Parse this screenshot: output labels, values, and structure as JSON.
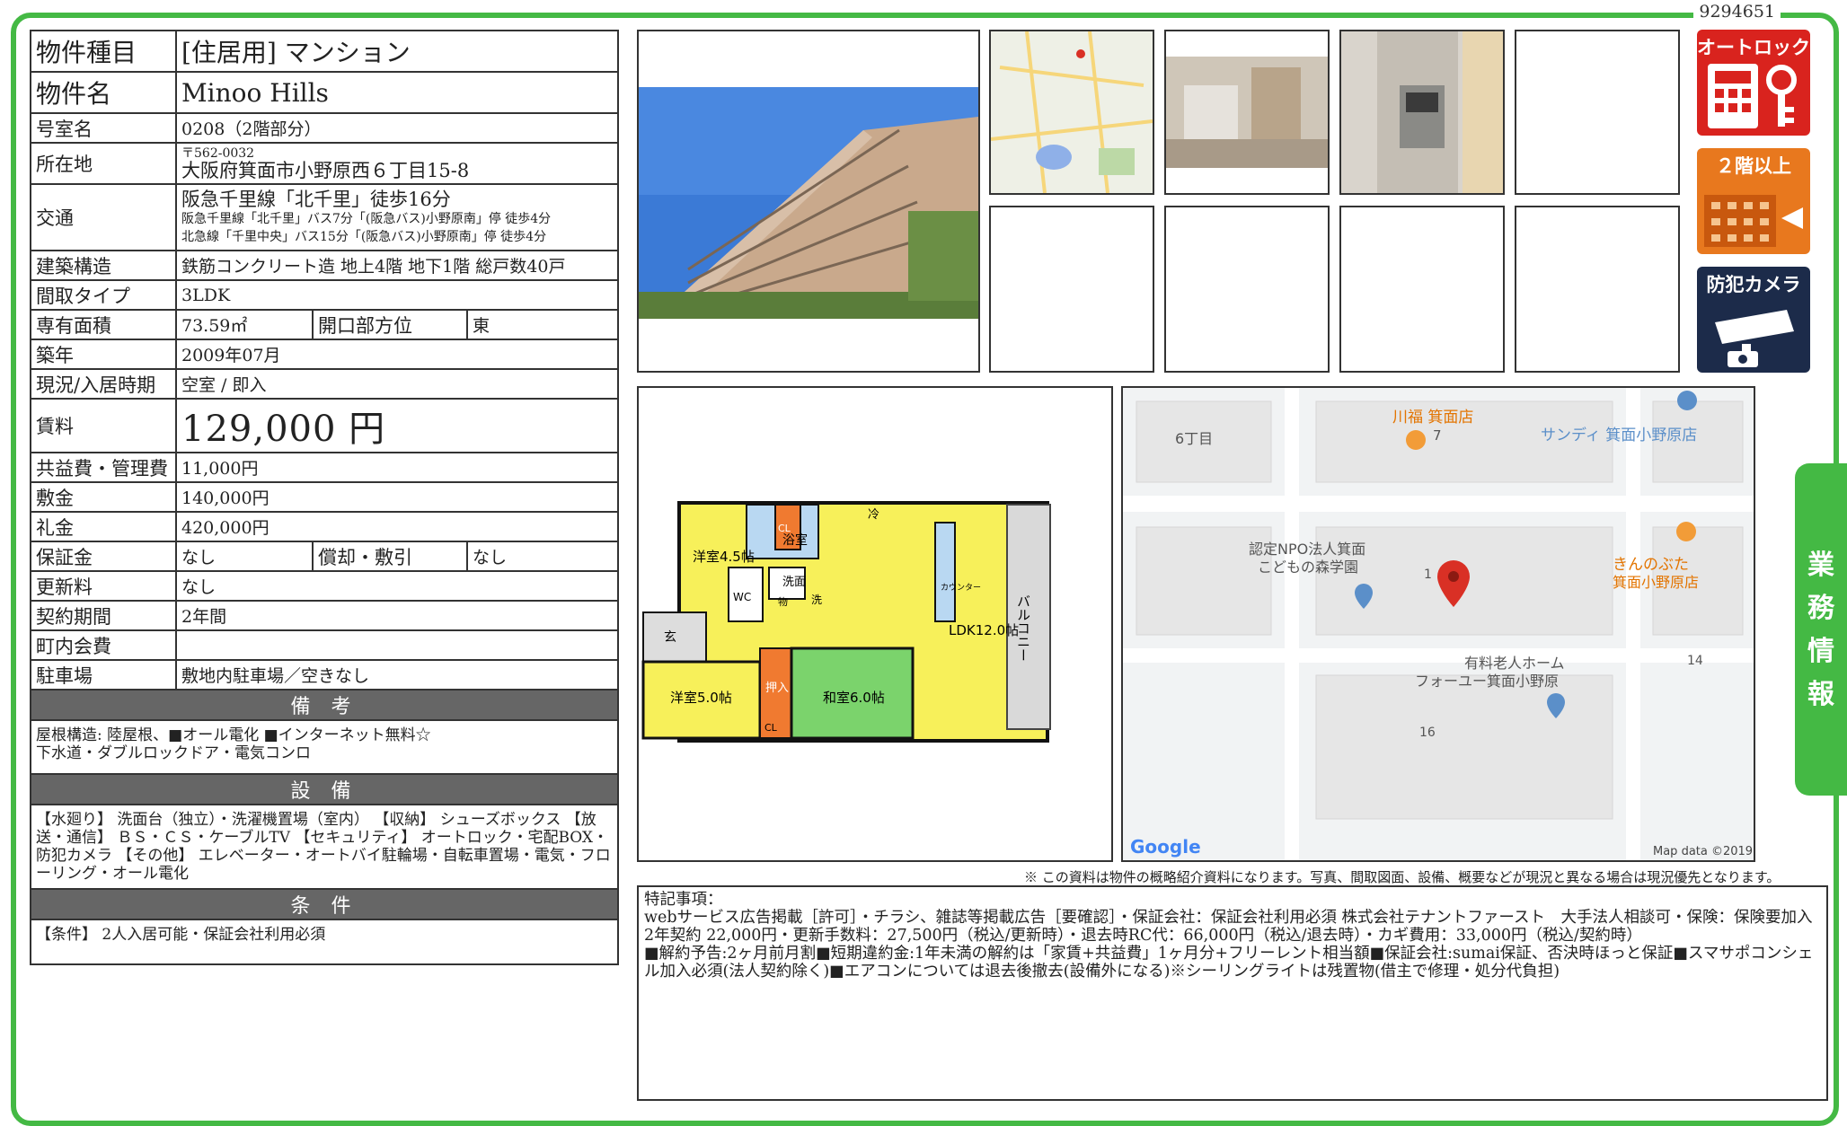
{
  "doc_id": "9294651",
  "property": {
    "type_label": "物件種目",
    "type_value": "[住居用] マンション",
    "name_label": "物件名",
    "name_value": "Minoo Hills",
    "room_label": "号室名",
    "room_value": "0208（2階部分）",
    "address_label": "所在地",
    "postal": "〒562-0032",
    "address": "大阪府箕面市小野原西６丁目15-8",
    "transit_label": "交通",
    "transit_main": "阪急千里線「北千里」徒歩16分",
    "transit_sub1": "阪急千里線「北千里」バス7分「(阪急バス)小野原南」停 徒歩4分",
    "transit_sub2": "北急線「千里中央」バス15分「(阪急バス)小野原南」停 徒歩4分",
    "structure_label": "建築構造",
    "structure_value": "鉄筋コンクリート造 地上4階 地下1階 総戸数40戸",
    "layout_label": "間取タイプ",
    "layout_value": "3LDK",
    "area_label": "専有面積",
    "area_value": "73.59㎡",
    "facing_label": "開口部方位",
    "facing_value": "東",
    "built_label": "築年",
    "built_value": "2009年07月",
    "status_label": "現況/入居時期",
    "status_value": "空室 / 即入",
    "rent_label": "賃料",
    "rent_value": "129,000 円",
    "fee_label": "共益費・管理費",
    "fee_value": "11,000円",
    "deposit_label": "敷金",
    "deposit_value": "140,000円",
    "key_money_label": "礼金",
    "key_money_value": "420,000円",
    "guarantee_label": "保証金",
    "guarantee_value": "なし",
    "amort_label": "償却・敷引",
    "amort_value": "なし",
    "renewal_label": "更新料",
    "renewal_value": "なし",
    "term_label": "契約期間",
    "term_value": "2年間",
    "community_label": "町内会費",
    "community_value": "",
    "parking_label": "駐車場",
    "parking_value": "敷地内駐車場／空きなし"
  },
  "sections": {
    "remarks_head": "備 考",
    "remarks_text": "屋根構造: 陸屋根、■オール電化 ■インターネット無料☆\n下水道・ダブルロックドア・電気コンロ",
    "equipment_head": "設 備",
    "equipment_text": "【水廻り】 洗面台（独立）・洗濯機置場（室内） 【収納】 シューズボックス 【放送・通信】 ＢＳ・ＣＳ・ケーブルTV 【セキュリティ】 オートロック・宅配BOX・防犯カメラ 【その他】 エレベーター・オートバイ駐輪場・自転車置場・電気・フローリング・オール電化",
    "conditions_head": "条 件",
    "conditions_text": "【条件】 2人入居可能・保証会社利用必須"
  },
  "floorplan": {
    "rooms": [
      "洋室4.5帖",
      "浴室",
      "洗面",
      "冷",
      "LDK12.0帖",
      "玄",
      "洋室5.0帖",
      "押入",
      "和室6.0帖",
      "CL",
      "CL",
      "WC",
      "物",
      "洗",
      "カウンター"
    ],
    "balcony": "バルコニー"
  },
  "map": {
    "labels": [
      "6丁目",
      "川福 箕面店",
      "7",
      "サンディ 箕面小野原店",
      "認定NPO法人箕面",
      "こどもの森学園",
      "1",
      "きんのぶた",
      "箕面小野原店",
      "有料老人ホーム",
      "フォーユー箕面小野原",
      "14",
      "16"
    ],
    "logo": "Google",
    "credit": "Map data ©2019"
  },
  "badges": {
    "autolock": "オートロック",
    "floor": "２階以上",
    "camera": "防犯カメラ"
  },
  "side_tab": [
    "業",
    "務",
    "情",
    "報"
  ],
  "disclaimer": "※ この資料は物件の概略紹介資料になります。写真、間取図面、設備、概要などが現況と異なる場合は現況優先となります。",
  "special_notes": {
    "title": "特記事項：",
    "line1": "webサービス広告掲載［許可］・チラシ、雑誌等掲載広告［要確認］・保証会社：保証会社利用必須 株式会社テナントファースト　大手法人相談可・保険：保険要加入 2年契約 22,000円・更新手数料：27,500円（税込/更新時）・退去時RC代：66,000円（税込/退去時）・カギ費用：33,000円（税込/契約時）",
    "line2": "■解約予告:2ヶ月前月割■短期違約金:1年未満の解約は「家賃+共益費」1ヶ月分+フリーレント相当額■保証会社:sumai保証、否決時ほっと保証■スマサポコンシェル加入必須(法人契約除く)■エアコンについては退去後撤去(設備外になる)※シーリングライトは残置物(借主で修理・処分代負担)"
  },
  "colors": {
    "frame": "#44b944",
    "badge_red": "#d9231e",
    "badge_orange": "#e8781e",
    "badge_navy": "#1c2b4a",
    "section_gray": "#666666"
  }
}
